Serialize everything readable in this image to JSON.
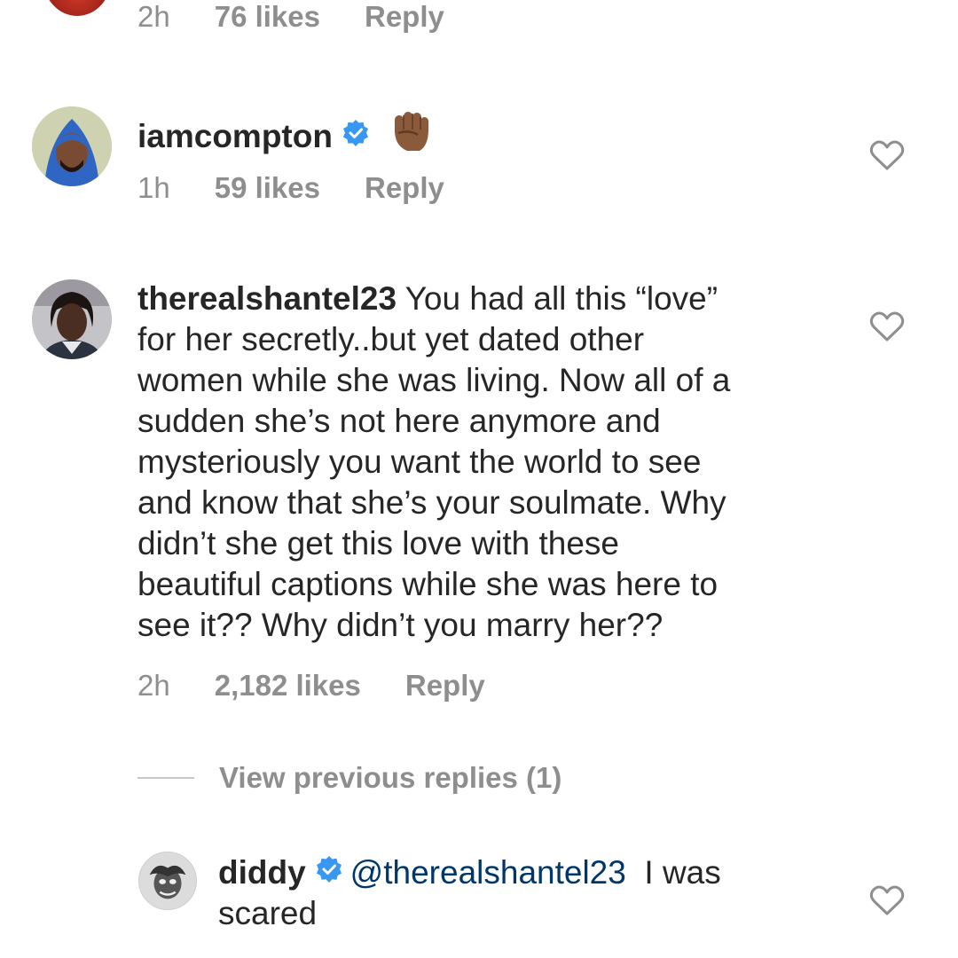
{
  "top_comment": {
    "time": "2h",
    "likes": "76 likes",
    "reply": "Reply"
  },
  "comment_compton": {
    "username": "iamcompton",
    "verified": true,
    "emoji": "✊🏾",
    "time": "1h",
    "likes": "59 likes",
    "reply": "Reply"
  },
  "comment_shantel": {
    "username": "therealshantel23",
    "lines": [
      " You had all this “love”",
      "for her secretly..but yet dated other",
      "women while she was living. Now all of a",
      "sudden she’s not here anymore and",
      "mysteriously you want the world to see",
      "and know that she’s your soulmate. Why",
      "didn’t she get this love with these",
      "beautiful captions while she was here to",
      "see it?? Why didn’t you marry her??"
    ],
    "time": "2h",
    "likes": "2,182 likes",
    "reply": "Reply"
  },
  "view_previous_replies": "View previous replies (1)",
  "reply_diddy": {
    "username": "diddy",
    "verified": true,
    "mention": "@therealshantel23",
    "text_line1": "  I was",
    "text_line2": "scared"
  },
  "colors": {
    "text": "#262626",
    "meta": "#8e8e8e",
    "verified_blue": "#3897f0",
    "mention": "#00376b"
  }
}
